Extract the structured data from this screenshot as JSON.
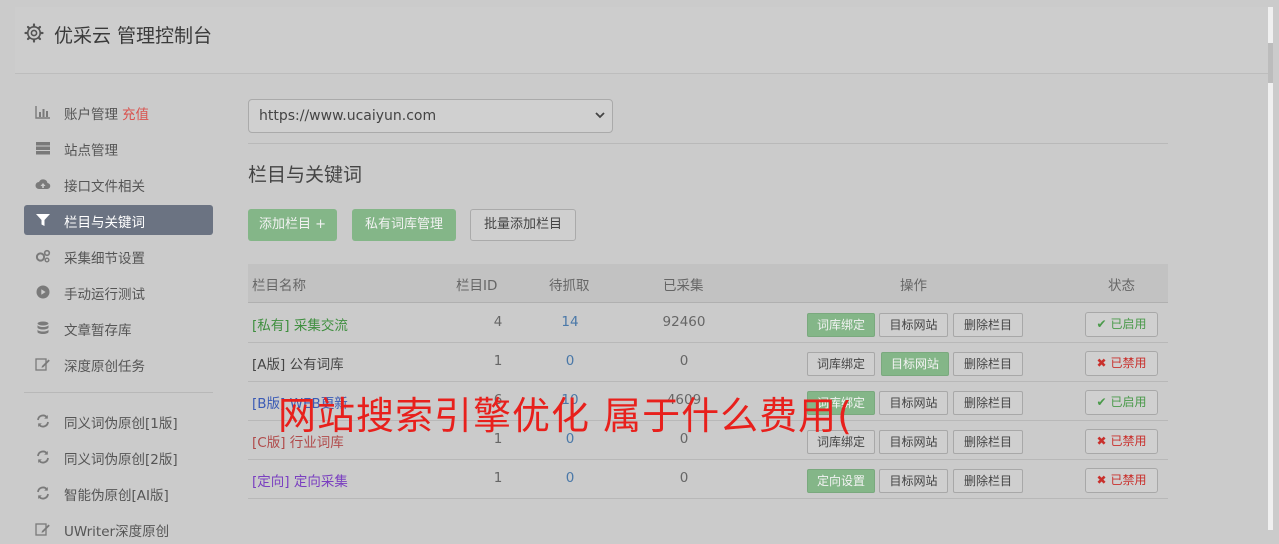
{
  "header": {
    "title": "优采云 管理控制台"
  },
  "sidebar": {
    "items": [
      {
        "label": "账户管理",
        "badge": "充值",
        "icon": "bar-chart-icon"
      },
      {
        "label": "站点管理",
        "icon": "server-icon"
      },
      {
        "label": "接口文件相关",
        "icon": "cloud-upload-icon"
      },
      {
        "label": "栏目与关键词",
        "icon": "filter-icon",
        "active": true
      },
      {
        "label": "采集细节设置",
        "icon": "gears-icon"
      },
      {
        "label": "手动运行测试",
        "icon": "play-circle-icon"
      },
      {
        "label": "文章暂存库",
        "icon": "database-icon"
      },
      {
        "label": "深度原创任务",
        "icon": "edit-icon"
      },
      {
        "label": "同义词伪原创[1版]",
        "icon": "refresh-icon"
      },
      {
        "label": "同义词伪原创[2版]",
        "icon": "refresh-icon"
      },
      {
        "label": "智能伪原创[AI版]",
        "icon": "refresh-icon"
      },
      {
        "label": "UWriter深度原创",
        "icon": "edit-icon"
      }
    ]
  },
  "site_select": {
    "value": "https://www.ucaiyun.com"
  },
  "section": {
    "title": "栏目与关键词"
  },
  "toolbar": {
    "add_column": "添加栏目 +",
    "private_lexicon": "私有词库管理",
    "batch_add": "批量添加栏目"
  },
  "table": {
    "headers": {
      "name": "栏目名称",
      "id": "栏目ID",
      "pending": "待抓取",
      "collected": "已采集",
      "actions": "操作",
      "status": "状态"
    },
    "rows": [
      {
        "tag": "[私有]",
        "name": "采集交流",
        "id": "4",
        "pending": "14",
        "collected": "92460",
        "btn1": "词库绑定",
        "btn2": "目标网站",
        "btn3": "删除栏目",
        "status": "已启用",
        "name_color": "#3f8f3f"
      },
      {
        "tag": "[A版]",
        "name": "公有词库",
        "id": "1",
        "pending": "0",
        "collected": "0",
        "btn1": "词库绑定",
        "btn2": "目标网站",
        "btn3": "删除栏目",
        "status": "已禁用",
        "name_color": "#444444"
      },
      {
        "tag": "[B版]",
        "name": "WEB更新",
        "id": "6",
        "pending": "10",
        "collected": "4609",
        "btn1": "词库绑定",
        "btn2": "目标网站",
        "btn3": "删除栏目",
        "status": "已启用",
        "name_color": "#3b5bb5"
      },
      {
        "tag": "[C版]",
        "name": "行业词库",
        "id": "1",
        "pending": "0",
        "collected": "0",
        "btn1": "词库绑定",
        "btn2": "目标网站",
        "btn3": "删除栏目",
        "status": "已禁用",
        "name_color": "#b04a4a"
      },
      {
        "tag": "[定向]",
        "name": "定向采集",
        "id": "1",
        "pending": "0",
        "collected": "0",
        "btn1": "定向设置",
        "btn2": "目标网站",
        "btn3": "删除栏目",
        "status": "已禁用",
        "name_color": "#7a3fc0"
      }
    ]
  },
  "overlay_text": "网站搜索引擎优化 属于什么费用(",
  "colors": {
    "accent_green": "#84b688",
    "active_sidebar": "#6b7382",
    "danger": "#d9534f"
  }
}
